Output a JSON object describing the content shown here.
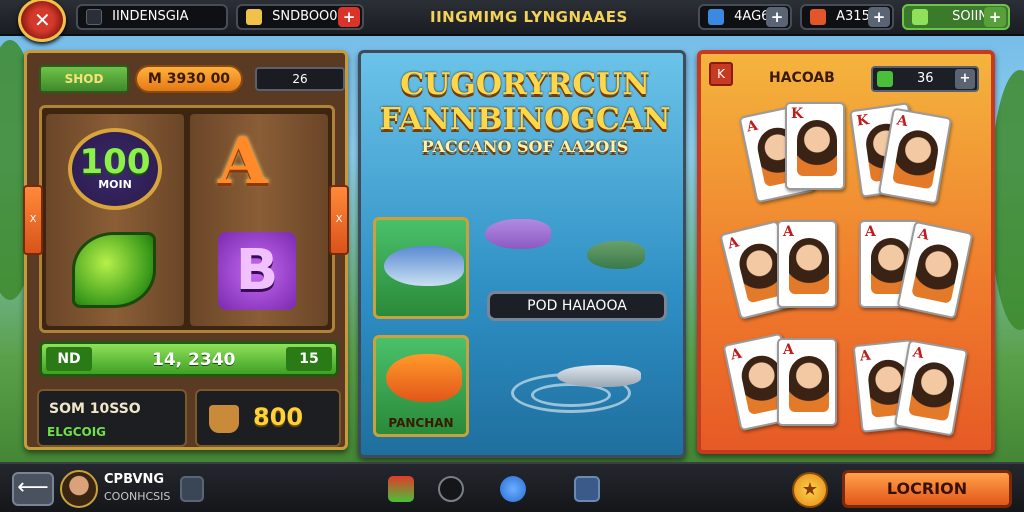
{
  "topbar": {
    "region_label": "IINDENSGIA",
    "coins_label": "SNDBOO0 A",
    "title": "IINGMIMG LYNGNAAES",
    "stat1": "4AG6",
    "stat2": "A315",
    "stat3": "SOIIN",
    "plus": "+"
  },
  "slot": {
    "tag_green": "SHOD",
    "tag_orange": "M 3930 00",
    "tag_dark": "26",
    "symbol_100_num": "100",
    "symbol_100_txt": "MOIN",
    "symbol_a": "A",
    "symbol_b": "B",
    "side_left": "X",
    "side_right": "X",
    "bar_left": "ND",
    "bar_value": "14, 2340",
    "bar_right": "15",
    "box1_line1": "SOM 10SSO",
    "box1_line2": "ELGCOIG",
    "box2_value": "800"
  },
  "fishing": {
    "title_line1": "CUGORYRCUN",
    "title_line2": "FANNBINOGCAN",
    "title_line3": "PACCANO SOF AA2OIS",
    "button_label": "POD HAIAOOA",
    "tile2_caption": "PANCHAN"
  },
  "cards": {
    "header_label": "HACOAB",
    "header_value": "36",
    "plus": "+",
    "ranks": [
      "K",
      "A",
      "K",
      "A",
      "A",
      "A",
      "A",
      "A",
      "A",
      "A"
    ]
  },
  "bottombar": {
    "username": "CPBVNG",
    "subtext": "COONHCSIS",
    "location_button": "LOCRION",
    "back": "⟵",
    "star": "★"
  },
  "colors": {
    "accent_orange": "#e2561a",
    "accent_green": "#3ea024",
    "gold": "#ffd84a"
  }
}
